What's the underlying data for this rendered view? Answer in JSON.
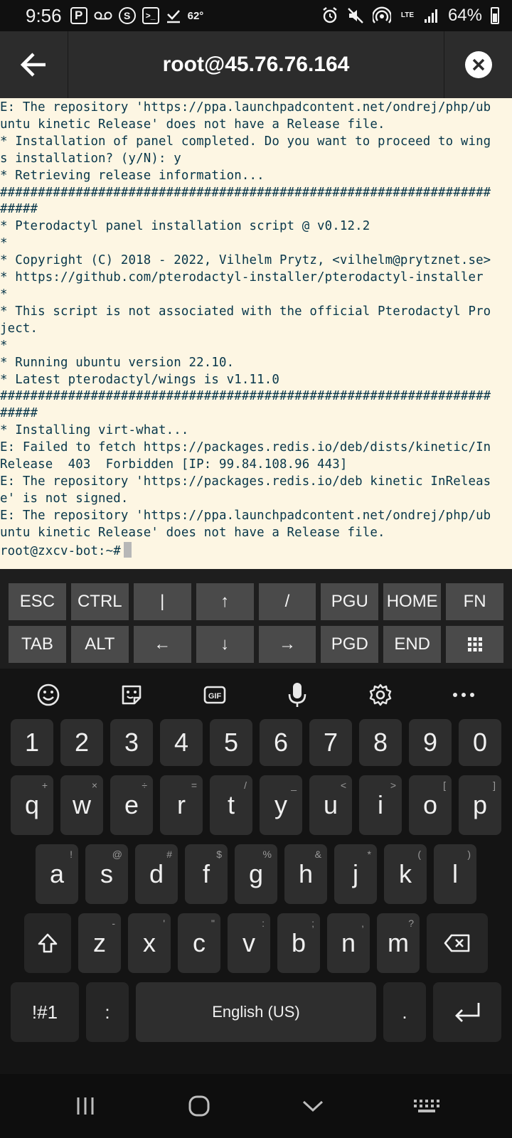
{
  "status_bar": {
    "time": "9:56",
    "temperature": "62°",
    "battery": "64%",
    "network": "LTE",
    "notif_p": "P",
    "notif_s": "S",
    "notif_term": ">_"
  },
  "app_bar": {
    "title": "root@45.76.76.164"
  },
  "terminal": {
    "lines": [
      "E: The repository 'https://ppa.launchpadcontent.net/ondrej/php/ub",
      "untu kinetic Release' does not have a Release file.",
      "* Installation of panel completed. Do you want to proceed to wing",
      "s installation? (y/N): y",
      "* Retrieving release information...",
      "#################################################################",
      "#####",
      "* Pterodactyl panel installation script @ v0.12.2",
      "*",
      "* Copyright (C) 2018 - 2022, Vilhelm Prytz, <vilhelm@prytznet.se>",
      "* https://github.com/pterodactyl-installer/pterodactyl-installer",
      "*",
      "* This script is not associated with the official Pterodactyl Pro",
      "ject.",
      "*",
      "* Running ubuntu version 22.10.",
      "* Latest pterodactyl/wings is v1.11.0",
      "#################################################################",
      "#####",
      "* Installing virt-what...",
      "E: Failed to fetch https://packages.redis.io/deb/dists/kinetic/In",
      "Release  403  Forbidden [IP: 99.84.108.96 443]",
      "E: The repository 'https://packages.redis.io/deb kinetic InReleas",
      "e' is not signed.",
      "E: The repository 'https://ppa.launchpadcontent.net/ondrej/php/ub",
      "untu kinetic Release' does not have a Release file."
    ],
    "prompt": "root@zxcv-bot:~#"
  },
  "extra_keys": {
    "row1": [
      "ESC",
      "CTRL",
      "|",
      "↑",
      "/",
      "PGU",
      "HOME",
      "FN"
    ],
    "row2": [
      "TAB",
      "ALT",
      "←",
      "↓",
      "→",
      "PGD",
      "END",
      "⠿"
    ]
  },
  "keyboard": {
    "numbers": [
      "1",
      "2",
      "3",
      "4",
      "5",
      "6",
      "7",
      "8",
      "9",
      "0"
    ],
    "row_q": [
      {
        "k": "q",
        "h": "+"
      },
      {
        "k": "w",
        "h": "×"
      },
      {
        "k": "e",
        "h": "÷"
      },
      {
        "k": "r",
        "h": "="
      },
      {
        "k": "t",
        "h": "/"
      },
      {
        "k": "y",
        "h": "_"
      },
      {
        "k": "u",
        "h": "<"
      },
      {
        "k": "i",
        "h": ">"
      },
      {
        "k": "o",
        "h": "["
      },
      {
        "k": "p",
        "h": "]"
      }
    ],
    "row_a": [
      {
        "k": "a",
        "h": "!"
      },
      {
        "k": "s",
        "h": "@"
      },
      {
        "k": "d",
        "h": "#"
      },
      {
        "k": "f",
        "h": "$"
      },
      {
        "k": "g",
        "h": "%"
      },
      {
        "k": "h",
        "h": "&"
      },
      {
        "k": "j",
        "h": "*"
      },
      {
        "k": "k",
        "h": "("
      },
      {
        "k": "l",
        "h": ")"
      }
    ],
    "row_z": [
      {
        "k": "z",
        "h": "-"
      },
      {
        "k": "x",
        "h": "'"
      },
      {
        "k": "c",
        "h": "\""
      },
      {
        "k": "v",
        "h": ":"
      },
      {
        "k": "b",
        "h": ";"
      },
      {
        "k": "n",
        "h": ","
      },
      {
        "k": "m",
        "h": "?"
      }
    ],
    "symbols_label": "!#1",
    "colon_label": ":",
    "space_label": "English (US)",
    "period_label": "."
  }
}
